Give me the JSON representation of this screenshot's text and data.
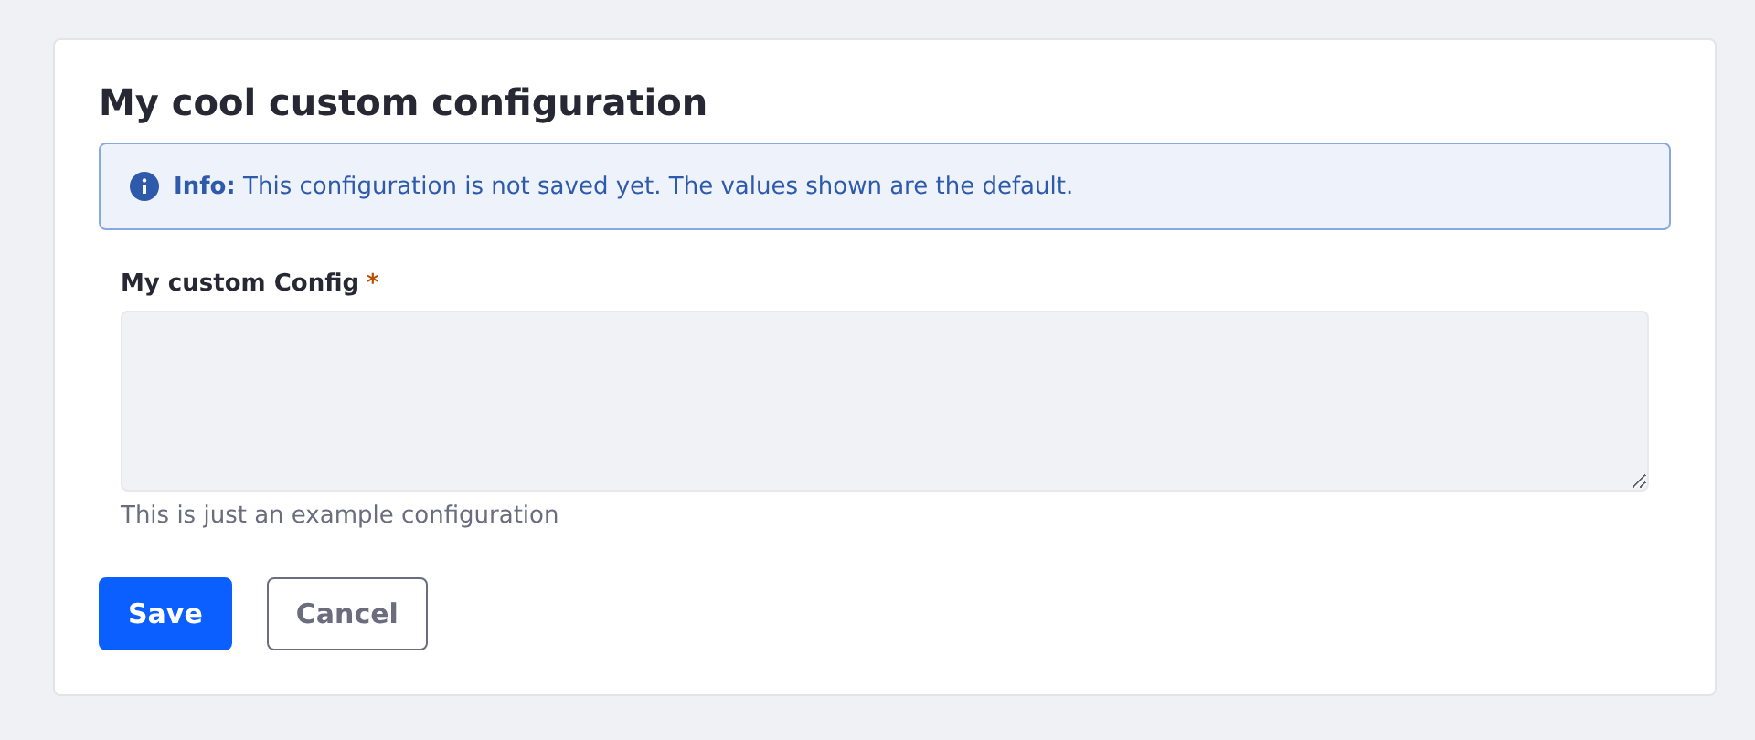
{
  "card": {
    "title": "My cool custom configuration",
    "alert": {
      "kind": "info",
      "text": "**Info:** This configuration is not saved yet. The values shown are the default."
    },
    "field": {
      "label": "My custom Config",
      "required_mark": "*",
      "help": "This is just an example configuration"
    },
    "buttons": [
      {
        "label": "Save",
        "kind": "primary"
      },
      {
        "label": "Cancel",
        "kind": "secondary"
      }
    ]
  }
}
